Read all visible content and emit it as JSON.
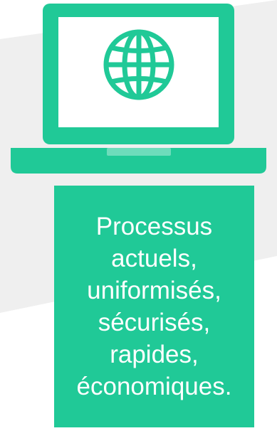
{
  "colors": {
    "accent": "#20C997",
    "background": "#FFFFFF",
    "shadow_shape": "#EFEFEF",
    "text": "#FFFFFF"
  },
  "illustration": {
    "device_icon": "laptop-icon",
    "screen_icon": "globe-icon"
  },
  "caption": {
    "lines": [
      "Processus",
      "actuels,",
      "uniformisés,",
      "sécurisés,",
      "rapides,",
      "économiques."
    ]
  }
}
